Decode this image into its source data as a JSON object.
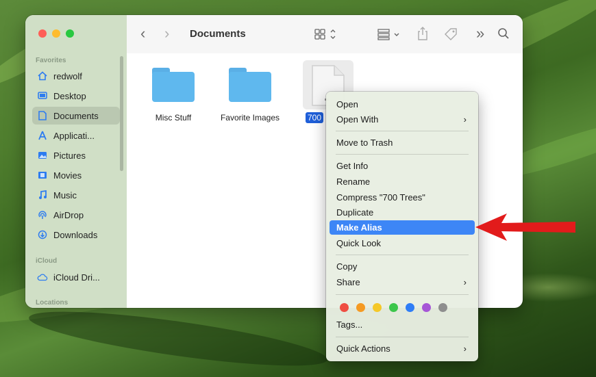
{
  "finder": {
    "toolbar": {
      "title": "Documents",
      "back_glyph": "‹",
      "forward_glyph": "›",
      "overflow_glyph": "»"
    },
    "sidebar": {
      "favorites_header": "Favorites",
      "favorites": [
        {
          "label": "redwolf",
          "icon": "home-icon"
        },
        {
          "label": "Desktop",
          "icon": "desktop-icon"
        },
        {
          "label": "Documents",
          "icon": "document-icon",
          "selected": true
        },
        {
          "label": "Applicati...",
          "icon": "applications-icon"
        },
        {
          "label": "Pictures",
          "icon": "pictures-icon"
        },
        {
          "label": "Movies",
          "icon": "movies-icon"
        },
        {
          "label": "Music",
          "icon": "music-icon"
        },
        {
          "label": "AirDrop",
          "icon": "airdrop-icon"
        },
        {
          "label": "Downloads",
          "icon": "downloads-icon"
        }
      ],
      "icloud_header": "iCloud",
      "icloud": [
        {
          "label": "iCloud Dri...",
          "icon": "cloud-icon"
        }
      ],
      "locations_header": "Locations"
    },
    "files": [
      {
        "name": "Misc Stuff",
        "kind": "folder"
      },
      {
        "name": "Favorite Images",
        "kind": "folder"
      },
      {
        "name": "700",
        "kind": "document",
        "selected": true
      }
    ]
  },
  "context_menu": {
    "items": {
      "open": "Open",
      "open_with": "Open With",
      "move_to_trash": "Move to Trash",
      "get_info": "Get Info",
      "rename": "Rename",
      "compress": "Compress \"700 Trees\"",
      "duplicate": "Duplicate",
      "make_alias": "Make Alias",
      "quick_look": "Quick Look",
      "copy": "Copy",
      "share": "Share",
      "tags": "Tags...",
      "quick_actions": "Quick Actions"
    },
    "submenu_glyph": "›",
    "highlighted": "Make Alias",
    "tag_colors": [
      "#ef4d42",
      "#f59a23",
      "#f5c828",
      "#3cc64b",
      "#2f7df6",
      "#a656d6",
      "#8e8e8e"
    ]
  },
  "colors": {
    "accent": "#3d86f6",
    "annotation_arrow": "#e21b1b",
    "folder": "#5fb8ee"
  }
}
